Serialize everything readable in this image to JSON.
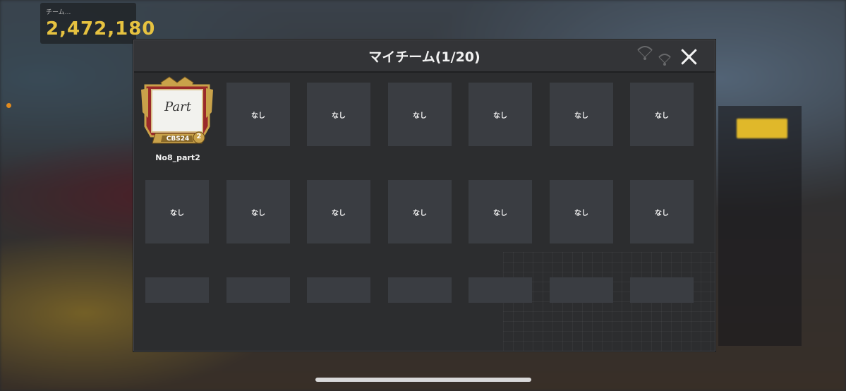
{
  "background": {
    "stat_label": "チーム...",
    "stat_value": "2,472,180"
  },
  "dialog": {
    "title": "マイチーム(1/20)",
    "close_icon": "close-icon",
    "decor_icon": "parachute-icon"
  },
  "team": {
    "badge_text": "Part",
    "badge_tag": "CBS24",
    "badge_level": "2",
    "name": "No8_part2"
  },
  "slots": {
    "empty_label": "なし"
  },
  "colors": {
    "slot_bg": "#3a3d42",
    "dialog_bg": "#2c2d2f",
    "badge_gold": "#c9a24a",
    "badge_red": "#9a2a2a"
  }
}
